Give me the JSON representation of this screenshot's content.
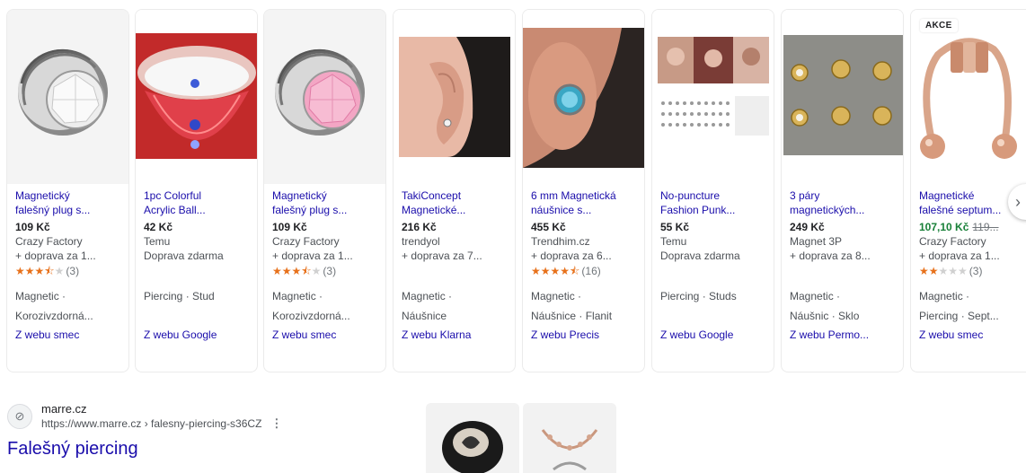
{
  "products": [
    {
      "title_line1": "Magnetický",
      "title_line2": "falešný plug s...",
      "price": "109 Kč",
      "store": "Crazy Factory",
      "shipping": "+ doprava za 1...",
      "rating_stars": 3.5,
      "rating_count": "(3)",
      "tag_line1": "Magnetic ·",
      "tag_line2": "Korozivzdorná...",
      "source": "Z webu smec"
    },
    {
      "title_line1": "1pc Colorful",
      "title_line2": "Acrylic Ball...",
      "price": "42 Kč",
      "store": "Temu",
      "shipping": "Doprava zdarma",
      "tag_line1": "Piercing · Stud",
      "tag_line2": "",
      "source": "Z webu Google"
    },
    {
      "title_line1": "Magnetický",
      "title_line2": "falešný plug s...",
      "price": "109 Kč",
      "store": "Crazy Factory",
      "shipping": "+ doprava za 1...",
      "rating_stars": 3.5,
      "rating_count": "(3)",
      "tag_line1": "Magnetic ·",
      "tag_line2": "Korozivzdorná...",
      "source": "Z webu smec"
    },
    {
      "title_line1": "TakiConcept",
      "title_line2": "Magnetické...",
      "price": "216 Kč",
      "store": "trendyol",
      "shipping": "+ doprava za 7...",
      "tag_line1": "Magnetic ·",
      "tag_line2": "Náušnice",
      "source": "Z webu Klarna"
    },
    {
      "title_line1": "6 mm Magnetická",
      "title_line2": "náušnice s...",
      "price": "455 Kč",
      "store": "Trendhim.cz",
      "shipping": "+ doprava za 6...",
      "rating_stars": 4.5,
      "rating_count": "(16)",
      "tag_line1": "Magnetic ·",
      "tag_line2": "Náušnice · Flanit",
      "source": "Z webu Precis"
    },
    {
      "title_line1": "No-puncture",
      "title_line2": "Fashion Punk...",
      "price": "55 Kč",
      "store": "Temu",
      "shipping": "Doprava zdarma",
      "tag_line1": "Piercing · Studs",
      "tag_line2": "",
      "source": "Z webu Google"
    },
    {
      "title_line1": "3 páry",
      "title_line2": "magnetických...",
      "price": "249 Kč",
      "store": "Magnet 3P",
      "shipping": "+ doprava za 8...",
      "tag_line1": "Magnetic ·",
      "tag_line2": "Náušnic · Sklo",
      "source": "Z webu Permo..."
    },
    {
      "badge": "AKCE",
      "title_line1": "Magnetické",
      "title_line2": "falešné septum...",
      "price": "107,10 Kč",
      "old_price": "119...",
      "store": "Crazy Factory",
      "shipping": "+ doprava za 1...",
      "rating_stars": 2,
      "rating_count": "(3)",
      "tag_line1": "Magnetic ·",
      "tag_line2": "Piercing · Sept...",
      "source": "Z webu smec"
    }
  ],
  "result": {
    "site_name": "marre.cz",
    "url": "https://www.marre.cz › falesny-piercing-s36CZ",
    "title": "Falešný piercing"
  },
  "icons": {
    "next": "chevron-right-icon",
    "favicon": "marre-favicon-icon",
    "more": "more-vert-icon"
  },
  "colors": {
    "link": "#1a0dab",
    "sale": "#188038",
    "star": "#e7711b"
  }
}
